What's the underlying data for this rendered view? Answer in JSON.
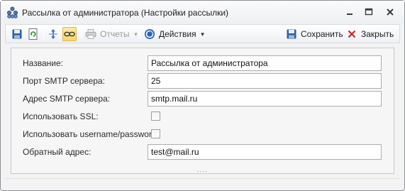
{
  "window": {
    "title": "Рассылка от администратора (Настройки рассылки)"
  },
  "toolbar": {
    "reports_label": "Отчеты",
    "actions_label": "Действия",
    "save_label": "Сохранить",
    "close_label": "Закрыть"
  },
  "form": {
    "name_label": "Название:",
    "name_value": "Рассылка от администратора",
    "smtp_port_label": "Порт SMTP сервера:",
    "smtp_port_value": "25",
    "smtp_address_label": "Адрес SMTP сервера:",
    "smtp_address_value": "smtp.mail.ru",
    "ssl_label": "Использовать SSL:",
    "ssl_checked": false,
    "auth_label": "Использовать username/password:",
    "auth_checked": false,
    "reply_address_label": "Обратный адрес:",
    "reply_address_value": "test@mail.ru"
  },
  "grip": "....",
  "colors": {
    "accent": "#2b63b5",
    "active_button": "#f8d768",
    "close_red": "#d42020"
  }
}
